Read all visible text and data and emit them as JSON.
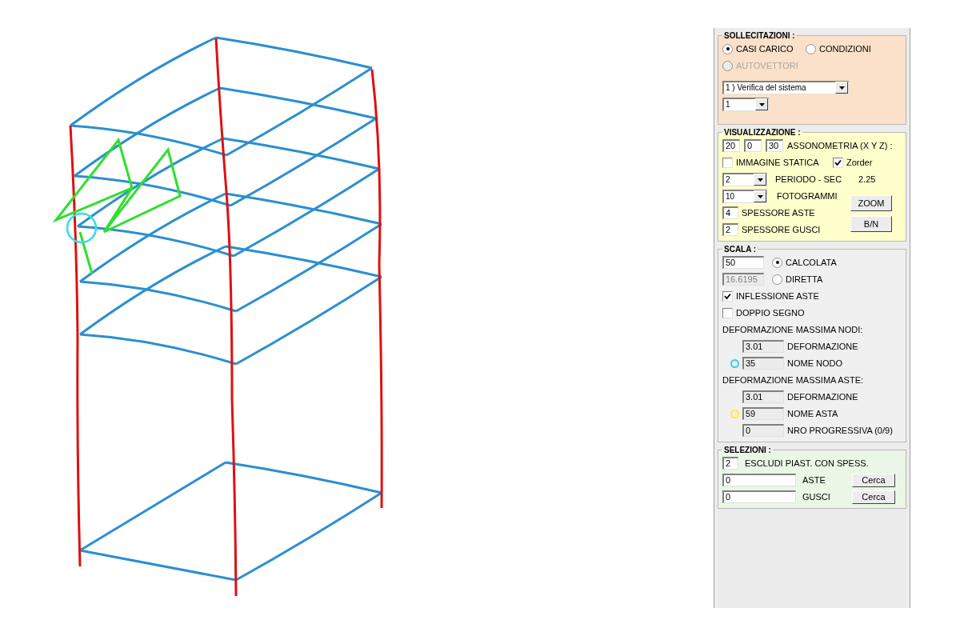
{
  "sollecitazioni": {
    "title": "SOLLECITAZIONI :",
    "options": [
      {
        "label": "CASI CARICO",
        "selected": true,
        "disabled": false
      },
      {
        "label": "CONDIZIONI",
        "selected": false,
        "disabled": false
      },
      {
        "label": "AUTOVETTORI",
        "selected": false,
        "disabled": true
      }
    ],
    "case_select": "1 ) Verifica del sistema",
    "sub_select": "1"
  },
  "visualizzazione": {
    "title": "VISUALIZZAZIONE :",
    "axonometry": [
      "20",
      "0",
      "30"
    ],
    "axonometry_label": "ASSONOMETRIA (X Y Z) :",
    "static_image": {
      "label": "IMMAGINE STATICA",
      "checked": false
    },
    "zorder": {
      "label": "Zorder",
      "checked": true
    },
    "period": {
      "value": "2",
      "label": "PERIODO - SEC",
      "reading": "2.25"
    },
    "frames": {
      "value": "10",
      "label": "FOTOGRAMMI"
    },
    "rod_thickness": {
      "value": "4",
      "label": "SPESSORE ASTE"
    },
    "shell_thickness": {
      "value": "2",
      "label": "SPESSORE GUSCI"
    },
    "buttons": [
      "ZOOM",
      "B/N"
    ]
  },
  "scala": {
    "title": "SCALA :",
    "modes": [
      {
        "value": "50",
        "label": "CALCOLATA",
        "selected": true,
        "disabled": false
      },
      {
        "value": "16.6195",
        "label": "DIRETTA",
        "selected": false,
        "disabled": true
      }
    ],
    "options": [
      {
        "label": "INFLESSIONE ASTE",
        "checked": true
      },
      {
        "label": "DOPPIO SEGNO",
        "checked": false
      }
    ],
    "groups": [
      {
        "heading": "DEFORMAZIONE MASSIMA NODI:",
        "rows": [
          {
            "value": "3.01",
            "label": "DEFORMAZIONE"
          },
          {
            "value": "35",
            "label": "NOME NODO",
            "color": "#33ccee"
          }
        ]
      },
      {
        "heading": "DEFORMAZIONE MASSIMA ASTE:",
        "rows": [
          {
            "value": "3.01",
            "label": "DEFORMAZIONE"
          },
          {
            "value": "59",
            "label": "NOME ASTA",
            "color": "#ffee33"
          },
          {
            "value": "0",
            "label": "NRO PROGRESSIVA (0/9)"
          }
        ]
      }
    ]
  },
  "selezioni": {
    "title": "SELEZIONI :",
    "exclude": {
      "value": "2",
      "label": "ESCLUDI PIAST. CON SPESS."
    },
    "rows": [
      {
        "value": "0",
        "label": "ASTE",
        "button": "Cerca"
      },
      {
        "value": "0",
        "label": "GUSCI",
        "button": "Cerca"
      }
    ]
  }
}
